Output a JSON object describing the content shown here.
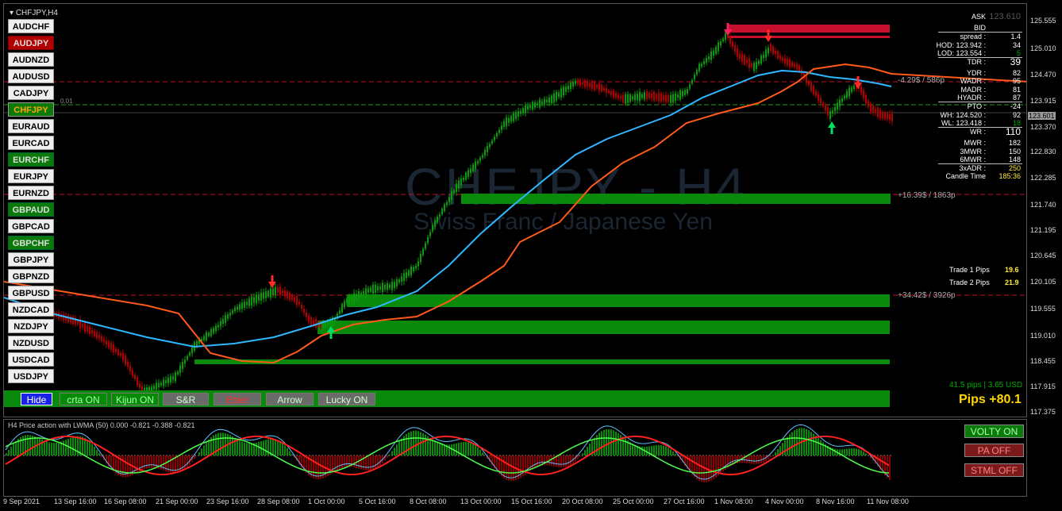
{
  "window": {
    "title": "CHFJPY,H4",
    "watermark_symbol": "CHFJPY - H4",
    "watermark_name": "Swiss Franc / Japanese Yen"
  },
  "symbols": [
    {
      "label": "AUDCHF",
      "style": "white"
    },
    {
      "label": "AUDJPY",
      "style": "red"
    },
    {
      "label": "AUDNZD",
      "style": "white"
    },
    {
      "label": "AUDUSD",
      "style": "white"
    },
    {
      "label": "CADJPY",
      "style": "white"
    },
    {
      "label": "CHFJPY",
      "style": "active"
    },
    {
      "label": "EURAUD",
      "style": "white"
    },
    {
      "label": "EURCAD",
      "style": "white"
    },
    {
      "label": "EURCHF",
      "style": "green"
    },
    {
      "label": "EURJPY",
      "style": "white"
    },
    {
      "label": "EURNZD",
      "style": "white"
    },
    {
      "label": "GBPAUD",
      "style": "green"
    },
    {
      "label": "GBPCAD",
      "style": "white"
    },
    {
      "label": "GBPCHF",
      "style": "green"
    },
    {
      "label": "GBPJPY",
      "style": "white"
    },
    {
      "label": "GBPNZD",
      "style": "white"
    },
    {
      "label": "GBPUSD",
      "style": "white"
    },
    {
      "label": "NZDCAD",
      "style": "white"
    },
    {
      "label": "NZDJPY",
      "style": "white"
    },
    {
      "label": "NZDUSD",
      "style": "white"
    },
    {
      "label": "USDCAD",
      "style": "white"
    },
    {
      "label": "USDJPY",
      "style": "white"
    }
  ],
  "toggle_buttons": {
    "hide": "Hide",
    "crta": "crta ON",
    "kijun": "Kijun ON",
    "sr": "S&R",
    "ehler": "Ehler",
    "arrow": "Arrow",
    "lucky": "Lucky ON"
  },
  "price_axis": [
    "125.555",
    "125.010",
    "124.470",
    "123.915",
    "123.370",
    "122.830",
    "122.285",
    "121.740",
    "121.195",
    "120.645",
    "120.105",
    "119.555",
    "119.010",
    "118.455",
    "117.915",
    "117.375"
  ],
  "current_price": "123.601",
  "info_panel": [
    {
      "label": "ASK",
      "value": "123.610",
      "vcolor": "#555",
      "vsize": "11px"
    },
    {
      "label": "BID",
      "value": "",
      "vcolor": "#fff",
      "vsize": "9px"
    },
    {
      "label": "spread :",
      "value": "1.4",
      "vcolor": "#fff",
      "vsize": "9px"
    },
    {
      "label": "HOD: 123.942 :",
      "value": "34",
      "vcolor": "#fff",
      "vsize": "9px"
    },
    {
      "label": "LOD: 123.554 :",
      "value": "5",
      "vcolor": "#0a0",
      "vsize": "9px"
    },
    {
      "label": "TDR :",
      "value": "39",
      "vcolor": "#fff",
      "vsize": "12px"
    },
    {
      "label": "YDR :",
      "value": "82",
      "vcolor": "#fff",
      "vsize": "9px"
    },
    {
      "label": "WADR :",
      "value": "95",
      "vcolor": "#fff",
      "vsize": "9px"
    },
    {
      "label": "MADR :",
      "value": "81",
      "vcolor": "#fff",
      "vsize": "9px"
    },
    {
      "label": "HYADR :",
      "value": "87",
      "vcolor": "#fff",
      "vsize": "9px"
    },
    {
      "label": "PTO :",
      "value": "-24",
      "vcolor": "#fff",
      "vsize": "9px"
    },
    {
      "label": "WH: 124.520 :",
      "value": "92",
      "vcolor": "#fff",
      "vsize": "9px"
    },
    {
      "label": "WL: 123.418 :",
      "value": "18",
      "vcolor": "#0a0",
      "vsize": "9px"
    },
    {
      "label": "WR :",
      "value": "110",
      "vcolor": "#fff",
      "vsize": "12px"
    },
    {
      "label": "MWR :",
      "value": "182",
      "vcolor": "#fff",
      "vsize": "9px"
    },
    {
      "label": "3MWR :",
      "value": "150",
      "vcolor": "#fff",
      "vsize": "9px"
    },
    {
      "label": "6MWR :",
      "value": "148",
      "vcolor": "#fff",
      "vsize": "9px"
    },
    {
      "label": "3xADR :",
      "value": "250",
      "vcolor": "#ffeb3b",
      "vsize": "9px"
    },
    {
      "label": "Candle Time",
      "value": "185:36",
      "vcolor": "#ffeb3b",
      "vsize": "9px"
    }
  ],
  "trades": {
    "t1_label": "Trade 1 Pips",
    "t1_value": "19.6",
    "t2_label": "Trade 2 Pips",
    "t2_value": "21.9"
  },
  "pips_small": "41.5 pips | 3.65 USD",
  "pips_big": "Pips +80.1",
  "line_labels": {
    "l1": "-4.29$ / 586p",
    "l2": "+16.39$ / 1863p",
    "l3": "+34.42$ / 3926p",
    "left_label": "0.01"
  },
  "subwindow": {
    "title": "H4 Price action with LWMA (50) 0.000 -0.821 -0.388 -0.821",
    "volty": "VOLTY ON",
    "pa": "PA OFF",
    "stml": "STML OFF"
  },
  "time_axis": [
    "9 Sep 2021",
    "13 Sep 16:00",
    "16 Sep 08:00",
    "21 Sep 00:00",
    "23 Sep 16:00",
    "28 Sep 08:00",
    "1 Oct 00:00",
    "5 Oct 16:00",
    "8 Oct 08:00",
    "13 Oct 00:00",
    "15 Oct 16:00",
    "20 Oct 08:00",
    "25 Oct 00:00",
    "27 Oct 16:00",
    "1 Nov 08:00",
    "4 Nov 00:00",
    "8 Nov 16:00",
    "11 Nov 08:00"
  ],
  "colors": {
    "ma_blue": "#2fb8ff",
    "ma_orange": "#ff5a1a",
    "bull": "#0b9a0b",
    "bear": "#b00000",
    "zone": "#0a8a0a",
    "resistance": "#c8102e"
  }
}
